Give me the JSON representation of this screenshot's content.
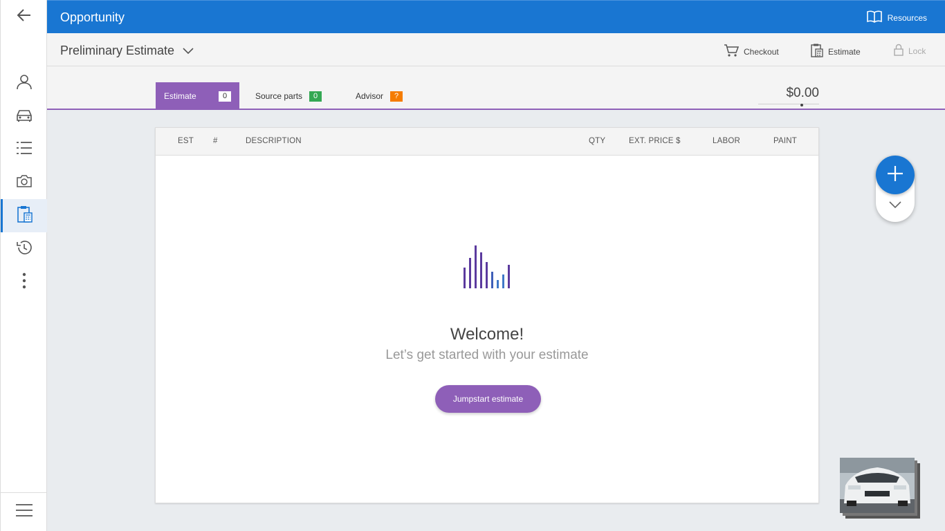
{
  "topbar": {
    "title": "Opportunity",
    "resources_label": "Resources"
  },
  "subbar": {
    "estimate_title": "Preliminary Estimate",
    "actions": {
      "checkout": "Checkout",
      "estimate": "Estimate",
      "lock": "Lock"
    }
  },
  "tabs": [
    {
      "label": "Estimate",
      "badge": "0",
      "active": true
    },
    {
      "label": "Source parts",
      "badge": "0"
    },
    {
      "label": "Advisor",
      "badge": "?"
    }
  ],
  "total": "$0.00",
  "table": {
    "headers": [
      "EST",
      "#",
      "DESCRIPTION",
      "QTY",
      "EXT. PRICE $",
      "LABOR",
      "PAINT"
    ]
  },
  "empty_state": {
    "heading": "Welcome!",
    "subheading": "Let’s get started with your estimate",
    "button": "Jumpstart estimate"
  },
  "sidebar": {
    "items": [
      "back-arrow-icon",
      "person-icon",
      "car-icon",
      "list-icon",
      "camera-icon",
      "estimate-clipboard-icon",
      "history-icon",
      "more-vertical-icon",
      "menu-icon"
    ],
    "active": "estimate-clipboard-icon"
  },
  "colors": {
    "primary_blue": "#1976d2",
    "accent_purple": "#8e5fb8",
    "badge_green": "#34a853",
    "badge_orange": "#f57c00"
  }
}
